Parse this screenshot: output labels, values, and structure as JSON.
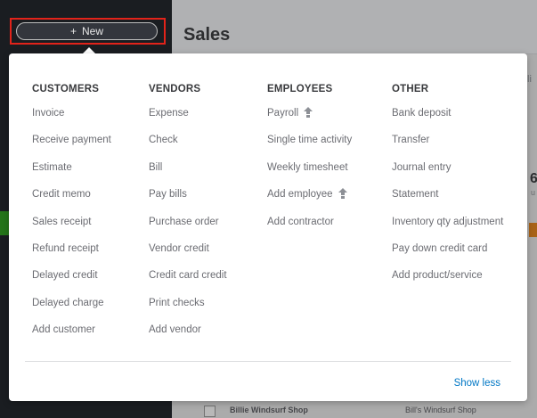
{
  "header": {
    "new_button_label": "New",
    "page_title": "Sales"
  },
  "background_fragments": {
    "top_right": "li",
    "mid_right_number": "6",
    "mid_right_small": "u"
  },
  "menu": {
    "columns": [
      {
        "heading": "CUSTOMERS",
        "items": [
          {
            "label": "Invoice"
          },
          {
            "label": "Receive payment"
          },
          {
            "label": "Estimate"
          },
          {
            "label": "Credit memo"
          },
          {
            "label": "Sales receipt"
          },
          {
            "label": "Refund receipt"
          },
          {
            "label": "Delayed credit"
          },
          {
            "label": "Delayed charge"
          },
          {
            "label": "Add customer"
          }
        ]
      },
      {
        "heading": "VENDORS",
        "items": [
          {
            "label": "Expense"
          },
          {
            "label": "Check"
          },
          {
            "label": "Bill"
          },
          {
            "label": "Pay bills"
          },
          {
            "label": "Purchase order"
          },
          {
            "label": "Vendor credit"
          },
          {
            "label": "Credit card credit"
          },
          {
            "label": "Print checks"
          },
          {
            "label": "Add vendor"
          }
        ]
      },
      {
        "heading": "EMPLOYEES",
        "items": [
          {
            "label": "Payroll",
            "icon": "upgrade-arrow-icon"
          },
          {
            "label": "Single time activity"
          },
          {
            "label": "Weekly timesheet"
          },
          {
            "label": "Add employee",
            "icon": "upgrade-arrow-icon"
          },
          {
            "label": "Add contractor"
          }
        ]
      },
      {
        "heading": "OTHER",
        "items": [
          {
            "label": "Bank deposit"
          },
          {
            "label": "Transfer"
          },
          {
            "label": "Journal entry"
          },
          {
            "label": "Statement"
          },
          {
            "label": "Inventory qty adjustment"
          },
          {
            "label": "Pay down credit card"
          },
          {
            "label": "Add product/service"
          }
        ]
      }
    ],
    "show_less_label": "Show less"
  },
  "footer_fragments": {
    "customer_name_1": "Billie Windsurf Shop",
    "customer_name_2": "Bill's Windsurf Shop"
  },
  "colors": {
    "accent_blue": "#0077c5",
    "highlight_red": "#e2231a",
    "upgrade_icon": "#8d9096"
  }
}
